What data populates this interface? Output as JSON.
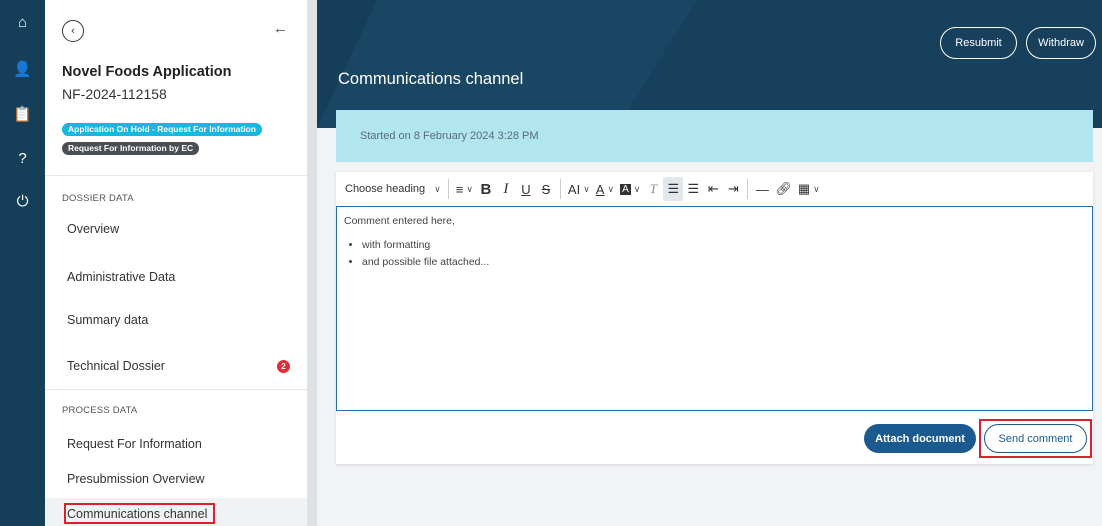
{
  "rail": {
    "items": [
      {
        "name": "home",
        "icon": "home-icon",
        "glyph": "⌂"
      },
      {
        "name": "user-settings",
        "icon": "user-gear-icon",
        "glyph": "👤"
      },
      {
        "name": "clipboard",
        "icon": "clipboard-icon",
        "glyph": "📋"
      },
      {
        "name": "help",
        "icon": "help-icon",
        "glyph": "?"
      },
      {
        "name": "power",
        "icon": "power-icon",
        "glyph": "⏻"
      }
    ]
  },
  "sidebar": {
    "title": "Novel Foods Application",
    "app_id": "NF-2024-112158",
    "badges": [
      {
        "label": "Application On Hold - Request For Information",
        "color": "#17b8e0"
      },
      {
        "label": "Request For Information by EC",
        "color": "#4a4f54"
      }
    ],
    "sections": [
      {
        "label": "DOSSIER DATA",
        "items": [
          {
            "label": "Overview"
          },
          {
            "label": "Administrative Data"
          },
          {
            "label": "Summary data"
          },
          {
            "label": "Technical Dossier",
            "count": "2"
          }
        ]
      },
      {
        "label": "PROCESS DATA",
        "items": [
          {
            "label": "Request For Information"
          },
          {
            "label": "Presubmission Overview"
          },
          {
            "label": "Communications channel",
            "active": true
          }
        ]
      }
    ]
  },
  "header": {
    "title": "Communications channel",
    "actions": {
      "resubmit": "Resubmit",
      "withdraw": "Withdraw"
    }
  },
  "info": {
    "started": "Started on 8 February 2024 3:28 PM"
  },
  "editor": {
    "heading_select": "Choose heading",
    "text": "Comment entered here,",
    "bullets": [
      "with formatting",
      "and possible file attached..."
    ]
  },
  "footer": {
    "attach_label": "Attach document",
    "send_label": "Send comment"
  },
  "colors": {
    "brand_dark": "#153e58",
    "accent": "#1a5a8f",
    "info_bg": "#b1e6f1",
    "highlight": "#d9232c"
  }
}
